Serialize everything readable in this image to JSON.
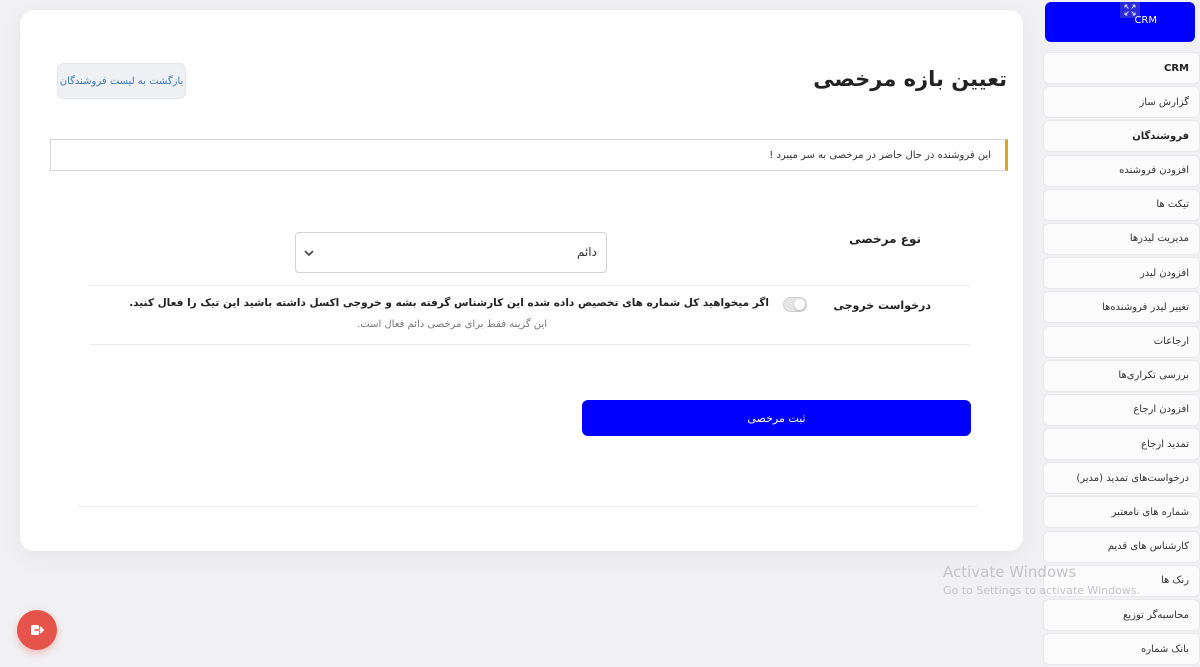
{
  "page": {
    "title": "تعیین بازه مرخصی",
    "back_button": "بازگشت به لیست فروشندگان"
  },
  "alert": {
    "text": "این فروشنده در حال حاضر در مرخصی به سر میبرد !",
    "accent_color": "#e0a21c"
  },
  "form": {
    "leave_type_label": "نوع مرخصی",
    "leave_type_value": "دائم",
    "export_request_label": "درخواست خروجی",
    "export_toggle_on": false,
    "export_toggle_text": "اگر میخواهید کل شماره های تخصیص داده شده این کارشناس گرفته بشه و خروجی اکسل داشته باشید این تیک را فعال کنید.",
    "export_note": "این گزینه فقط برای مرخصی دائم فعال است.",
    "submit_label": "ثبت مرخصی"
  },
  "sidebar": {
    "header_label": "CRM",
    "collapse_icon": "collapse-arrows-icon",
    "items": [
      {
        "label": "CRM",
        "bold": true
      },
      {
        "label": "گزارش ساز",
        "bold": false
      },
      {
        "label": "فروشندگان",
        "bold": true
      },
      {
        "label": "افزودن فروشنده",
        "bold": false
      },
      {
        "label": "تیکت ها",
        "bold": false
      },
      {
        "label": "مدیریت لیدرها",
        "bold": false
      },
      {
        "label": "افزودن لیدر",
        "bold": false
      },
      {
        "label": "تغییر لیدر فروشنده‌ها",
        "bold": false
      },
      {
        "label": "ارجاعات",
        "bold": false
      },
      {
        "label": "بررسی تکراری‌ها",
        "bold": false
      },
      {
        "label": "افزودن ارجاع",
        "bold": false
      },
      {
        "label": "تمدید ارجاع",
        "bold": false
      },
      {
        "label": "درخواست‌های تمدید (مدیر)",
        "bold": false
      },
      {
        "label": "شماره های نامعتبر",
        "bold": false
      },
      {
        "label": "کارشناس های قدیم",
        "bold": false
      },
      {
        "label": "رنک ها",
        "bold": false
      },
      {
        "label": "محاسبه‌گر توزیع",
        "bold": false
      },
      {
        "label": "بانک شماره",
        "bold": false
      }
    ]
  },
  "watermark": {
    "title": "Activate Windows",
    "subtitle": "Go to Settings to activate Windows."
  },
  "fab": {
    "icon": "logout-icon",
    "color": "#e5534b"
  },
  "colors": {
    "primary": "#0000ff",
    "back_button_text": "#3b77b8"
  }
}
